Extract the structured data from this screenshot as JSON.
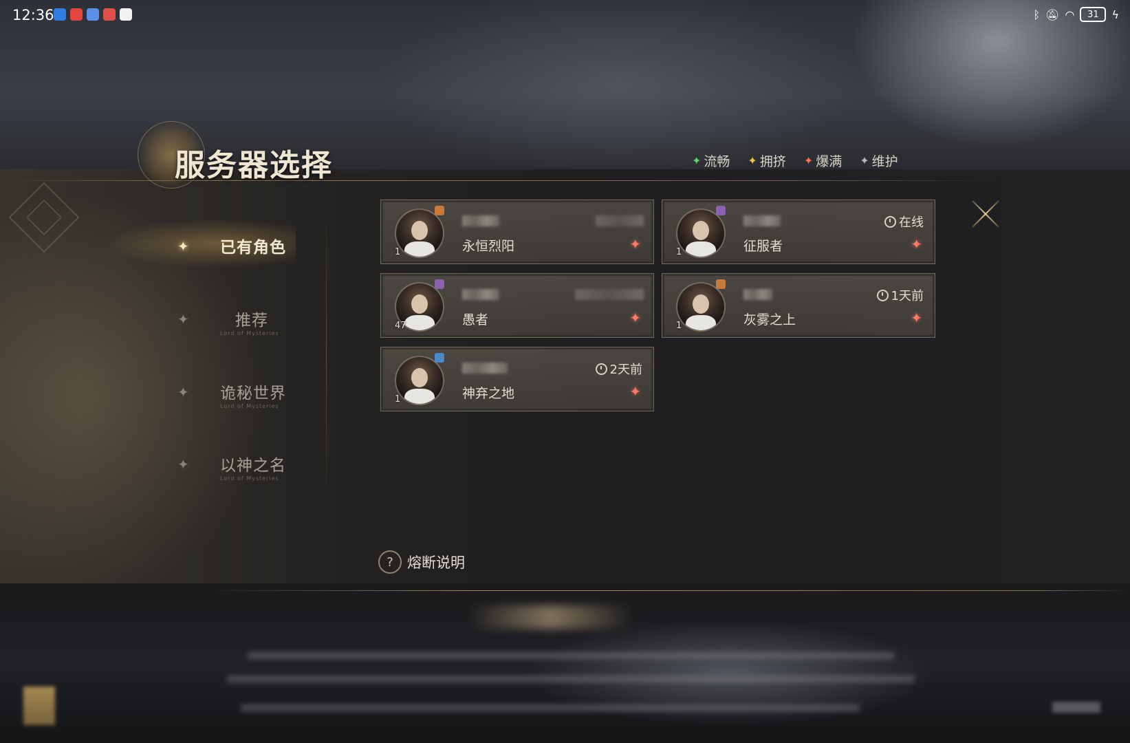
{
  "status_bar": {
    "time": "12:36",
    "battery": "31",
    "notification_icons": [
      "shield-app-icon",
      "red-app-icon",
      "blue-app-icon",
      "red-app-icon-2",
      "penguin-app-icon"
    ]
  },
  "header": {
    "title": "服务器选择",
    "legend": [
      {
        "label": "流畅",
        "color": "#5fd66a"
      },
      {
        "label": "拥挤",
        "color": "#f2c14e"
      },
      {
        "label": "爆满",
        "color": "#ff6e5a"
      },
      {
        "label": "维护",
        "color": "#b8b8b8"
      }
    ]
  },
  "sidebar": {
    "items": [
      {
        "label": "已有角色",
        "sublabel": "",
        "active": true
      },
      {
        "label": "推荐",
        "sublabel": "Lord of Mysteries",
        "active": false
      },
      {
        "label": "诡秘世界",
        "sublabel": "Lord of Mysteries",
        "active": false
      },
      {
        "label": "以神之名",
        "sublabel": "Lord of Mysteries",
        "active": false
      }
    ]
  },
  "servers": [
    {
      "name": "永恒烈阳",
      "level": "1",
      "last_login": "",
      "status_color": "#ff6e5a",
      "badge_color": "#c87a3a"
    },
    {
      "name": "征服者",
      "level": "1",
      "last_login": "在线",
      "status_color": "#ff6e5a",
      "badge_color": "#8a62b0"
    },
    {
      "name": "愚者",
      "level": "47",
      "last_login": "",
      "status_color": "#ff6e5a",
      "badge_color": "#8a62b0"
    },
    {
      "name": "灰雾之上",
      "level": "1",
      "last_login": "1天前",
      "status_color": "#ff6e5a",
      "badge_color": "#c87a3a"
    },
    {
      "name": "神弃之地",
      "level": "1",
      "last_login": "2天前",
      "status_color": "#ff6e5a",
      "badge_color": "#4a8ac8"
    }
  ],
  "help": {
    "label": "熔断说明"
  }
}
